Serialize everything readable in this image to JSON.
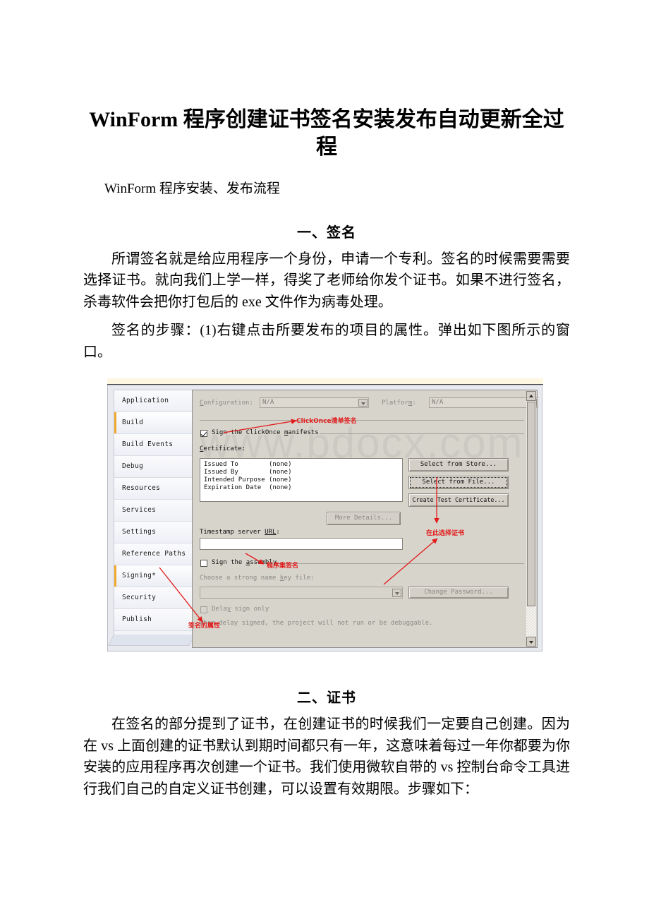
{
  "document": {
    "title": "WinForm 程序创建证书签名安装发布自动更新全过程",
    "subtitle": "WinForm 程序安装、发布流程",
    "section1_heading": "一、签名",
    "section1_para1": "所谓签名就是给应用程序一个身份，申请一个专利。签名的时候需要需要选择证书。就向我们上学一样，得奖了老师给你发个证书。如果不进行签名，杀毒软件会把你打包后的 exe 文件作为病毒处理。",
    "section1_para2": "签名的步骤：(1)右键点击所要发布的项目的属性。弹出如下图所示的窗口。",
    "section2_heading": "二、证书",
    "section2_para1": "在签名的部分提到了证书，在创建证书的时候我们一定要自己创建。因为在 vs 上面创建的证书默认到期时间都只有一年，这意味着每过一年你都要为你安装的应用程序再次创建一个证书。我们使用微软自带的 vs 控制台命令工具进行我们自己的自定义证书创建，可以设置有效期限。步骤如下："
  },
  "figure": {
    "watermark": "www.bdocx.com",
    "tabs": [
      {
        "label": "Application",
        "accent": false
      },
      {
        "label": "Build",
        "accent": true
      },
      {
        "label": "Build Events",
        "accent": false
      },
      {
        "label": "Debug",
        "accent": false
      },
      {
        "label": "Resources",
        "accent": false
      },
      {
        "label": "Services",
        "accent": false
      },
      {
        "label": "Settings",
        "accent": false
      },
      {
        "label": "Reference Paths",
        "accent": false
      },
      {
        "label": "Signing*",
        "accent": true
      },
      {
        "label": "Security",
        "accent": false
      },
      {
        "label": "Publish",
        "accent": false
      }
    ],
    "configuration_label": "Configuration:",
    "configuration_value": "N/A",
    "platform_label": "Platform:",
    "platform_value": "N/A",
    "sign_manifests_label": "Sign the ClickOnce manifests",
    "certificate_label": "Certificate:",
    "certificate_rows": [
      {
        "key": "Issued To",
        "value": "(none)"
      },
      {
        "key": "Issued By",
        "value": "(none)"
      },
      {
        "key": "Intended Purpose",
        "value": "(none)"
      },
      {
        "key": "Expiration Date",
        "value": "(none)"
      }
    ],
    "btn_select_store": "Select from Store...",
    "btn_select_file": "Select from File...",
    "btn_create_test_cert": "Create Test Certificate...",
    "btn_more_details": "More Details...",
    "timestamp_label": "Timestamp server URL:",
    "timestamp_value": "",
    "sign_assembly_label": "Sign the assembly",
    "key_file_label": "Choose a strong name key file:",
    "key_file_value": "",
    "btn_change_password": "Change Password...",
    "delay_sign_label": "Delay sign only",
    "delay_sign_note": "When delay signed, the project will not run or be debuggable.",
    "annotations": {
      "clickonce": "ClickOnce清单签名",
      "select_cert_here": "在此选择证书",
      "assembly_sign": "程序集签名",
      "signing_property": "签名的属性"
    },
    "colors": {
      "annotation_red": "#e21b1b",
      "tab_accent": "#f0a830",
      "pane_bg": "#d7d4cc"
    }
  }
}
